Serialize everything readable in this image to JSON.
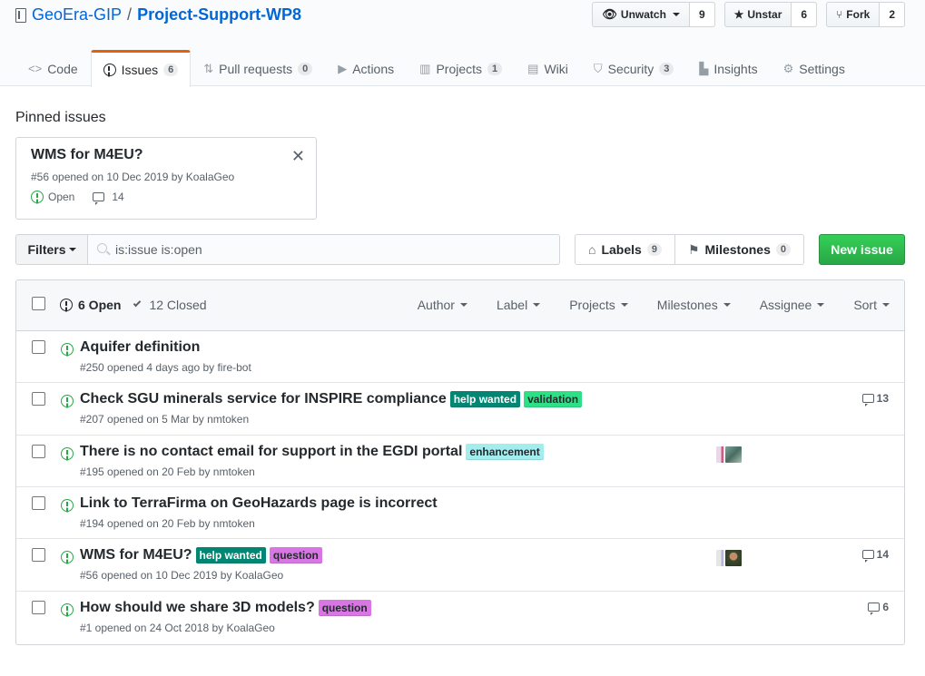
{
  "repo": {
    "owner": "GeoEra-GIP",
    "separator": "/",
    "name": "Project-Support-WP8"
  },
  "actions": {
    "watch": {
      "label": "Unwatch",
      "count": "9"
    },
    "star": {
      "label": "Unstar",
      "count": "6"
    },
    "fork": {
      "label": "Fork",
      "count": "2"
    }
  },
  "nav": {
    "code": {
      "label": "Code"
    },
    "issues": {
      "label": "Issues",
      "count": "6"
    },
    "pulls": {
      "label": "Pull requests",
      "count": "0"
    },
    "actions": {
      "label": "Actions"
    },
    "projects": {
      "label": "Projects",
      "count": "1"
    },
    "wiki": {
      "label": "Wiki"
    },
    "security": {
      "label": "Security",
      "count": "3"
    },
    "insights": {
      "label": "Insights"
    },
    "settings": {
      "label": "Settings"
    }
  },
  "pinned": {
    "heading": "Pinned issues",
    "title": "WMS for M4EU?",
    "meta": "#56 opened on 10 Dec 2019 by KoalaGeo",
    "state": "Open",
    "comments": "14"
  },
  "filterbar": {
    "filters_label": "Filters",
    "search_value": "is:issue is:open",
    "labels_label": "Labels",
    "labels_count": "9",
    "milestones_label": "Milestones",
    "milestones_count": "0",
    "new_issue_label": "New issue"
  },
  "list_header": {
    "open_label": "6 Open",
    "closed_label": "12 Closed",
    "filters": [
      "Author",
      "Label",
      "Projects",
      "Milestones",
      "Assignee",
      "Sort"
    ]
  },
  "colors": {
    "help_wanted": "#008672",
    "validation": "#2ee085",
    "enhancement": "#a2eeef",
    "question": "#d876e3",
    "open_green": "#28a745",
    "new_issue_green": "#28a745",
    "tab_accent": "#e36209"
  },
  "issues": [
    {
      "title": "Aquifer definition",
      "meta": "#250 opened 4 days ago by fire-bot",
      "labels": [],
      "comments": ""
    },
    {
      "title": "Check SGU minerals service for INSPIRE compliance",
      "meta": "#207 opened on 5 Mar by nmtoken",
      "labels": [
        "help wanted",
        "validation"
      ],
      "comments": "13"
    },
    {
      "title": "There is no contact email for support in the EGDI portal",
      "meta": "#195 opened on 20 Feb by nmtoken",
      "labels": [
        "enhancement"
      ],
      "comments": ""
    },
    {
      "title": "Link to TerraFirma on GeoHazards page is incorrect",
      "meta": "#194 opened on 20 Feb by nmtoken",
      "labels": [],
      "comments": ""
    },
    {
      "title": "WMS for M4EU?",
      "meta": "#56 opened on 10 Dec 2019 by KoalaGeo",
      "labels": [
        "help wanted",
        "question"
      ],
      "comments": "14"
    },
    {
      "title": "How should we share 3D models?",
      "meta": "#1 opened on 24 Oct 2018 by KoalaGeo",
      "labels": [
        "question"
      ],
      "comments": "6"
    }
  ]
}
